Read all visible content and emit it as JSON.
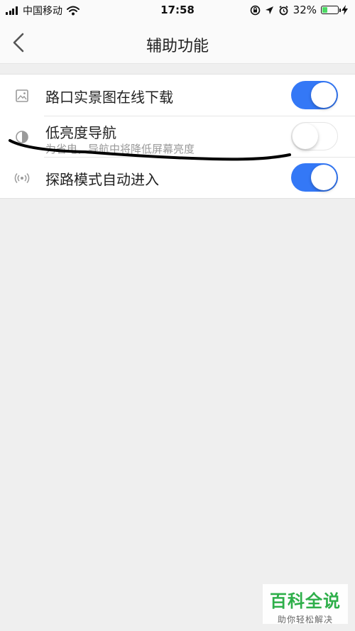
{
  "status_bar": {
    "carrier": "中国移动",
    "time": "17:58",
    "battery_percent": "32%",
    "battery_level": 0.32,
    "icons": [
      "signal-icon",
      "wifi-icon",
      "rotation-lock-icon",
      "location-icon",
      "alarm-icon",
      "battery-icon",
      "charging-icon"
    ]
  },
  "nav": {
    "title": "辅助功能",
    "back_icon": "chevron-left-icon"
  },
  "settings": {
    "items": [
      {
        "label": "路口实景图在线下载",
        "icon": "image-icon",
        "enabled": true
      },
      {
        "label": "低亮度导航",
        "subtitle": "为省电，导航中将降低屏幕亮度",
        "icon": "brightness-icon",
        "enabled": false
      },
      {
        "label": "探路模式自动进入",
        "icon": "broadcast-icon",
        "enabled": true
      }
    ]
  },
  "colors": {
    "toggle_on": "#3478f6",
    "toggle_off": "#ffffff",
    "background": "#efefef",
    "watermark_green": "#2eaf4a"
  },
  "watermark": {
    "main": "百科全说",
    "sub": "助你轻松解决"
  }
}
